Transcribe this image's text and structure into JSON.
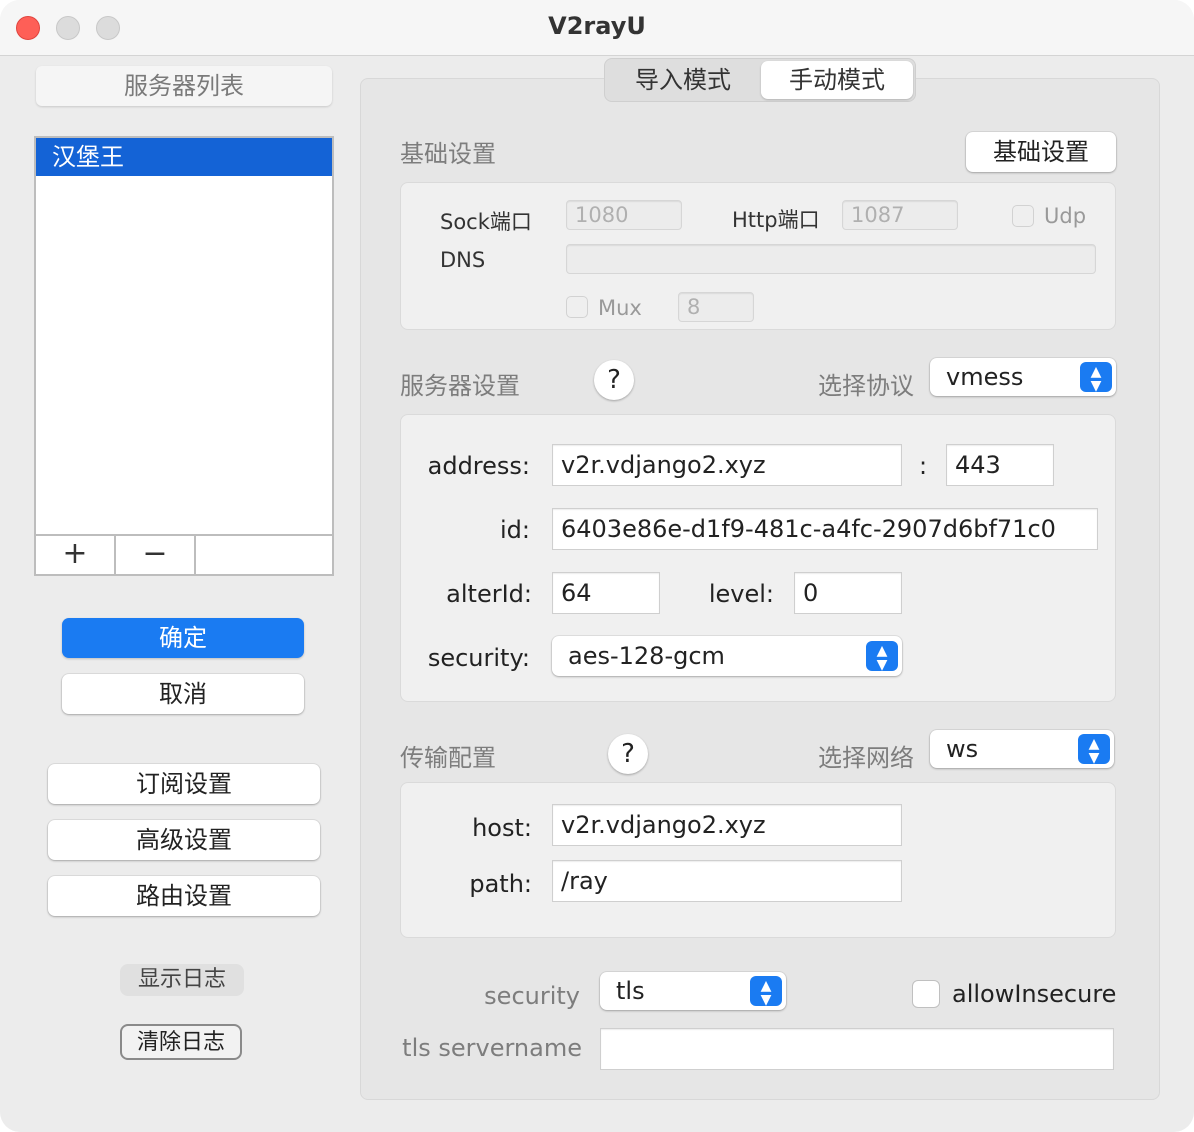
{
  "window": {
    "title": "V2rayU"
  },
  "sidebar": {
    "header": "服务器列表",
    "servers": [
      "汉堡王"
    ],
    "add_label": "+",
    "remove_label": "−",
    "confirm_label": "确定",
    "cancel_label": "取消",
    "subscribe_label": "订阅设置",
    "advanced_label": "高级设置",
    "routing_label": "路由设置",
    "show_log_label": "显示日志",
    "clear_log_label": "清除日志"
  },
  "tabs": {
    "import": "导入模式",
    "manual": "手动模式",
    "active": "manual"
  },
  "basic": {
    "section_label": "基础设置",
    "button_label": "基础设置",
    "sock_label": "Sock端口",
    "sock_value": "1080",
    "http_label": "Http端口",
    "http_value": "1087",
    "udp_label": "Udp",
    "udp_checked": false,
    "dns_label": "DNS",
    "dns_value": "",
    "mux_label": "Mux",
    "mux_checked": false,
    "mux_value": "8"
  },
  "server": {
    "section_label": "服务器设置",
    "help": "?",
    "protocol_label": "选择协议",
    "protocol_value": "vmess",
    "address_label": "address:",
    "address_value": "v2r.vdjango2.xyz",
    "port_sep": ":",
    "port_value": "443",
    "id_label": "id:",
    "id_value": "6403e86e-d1f9-481c-a4fc-2907d6bf71c0",
    "alterid_label": "alterId:",
    "alterid_value": "64",
    "level_label": "level:",
    "level_value": "0",
    "security_label": "security:",
    "security_value": "aes-128-gcm"
  },
  "transport": {
    "section_label": "传输配置",
    "help": "?",
    "network_label": "选择网络",
    "network_value": "ws",
    "host_label": "host:",
    "host_value": "v2r.vdjango2.xyz",
    "path_label": "path:",
    "path_value": "/ray"
  },
  "tls": {
    "security_label": "security",
    "security_value": "tls",
    "allow_insecure_label": "allowInsecure",
    "allow_insecure_checked": false,
    "servername_label": "tls servername",
    "servername_value": ""
  },
  "colors": {
    "accent": "#1a7bf2",
    "selection": "#1463d6",
    "close": "#fe5f57"
  },
  "icons": {
    "stepper": "updown-chevron-icon"
  }
}
